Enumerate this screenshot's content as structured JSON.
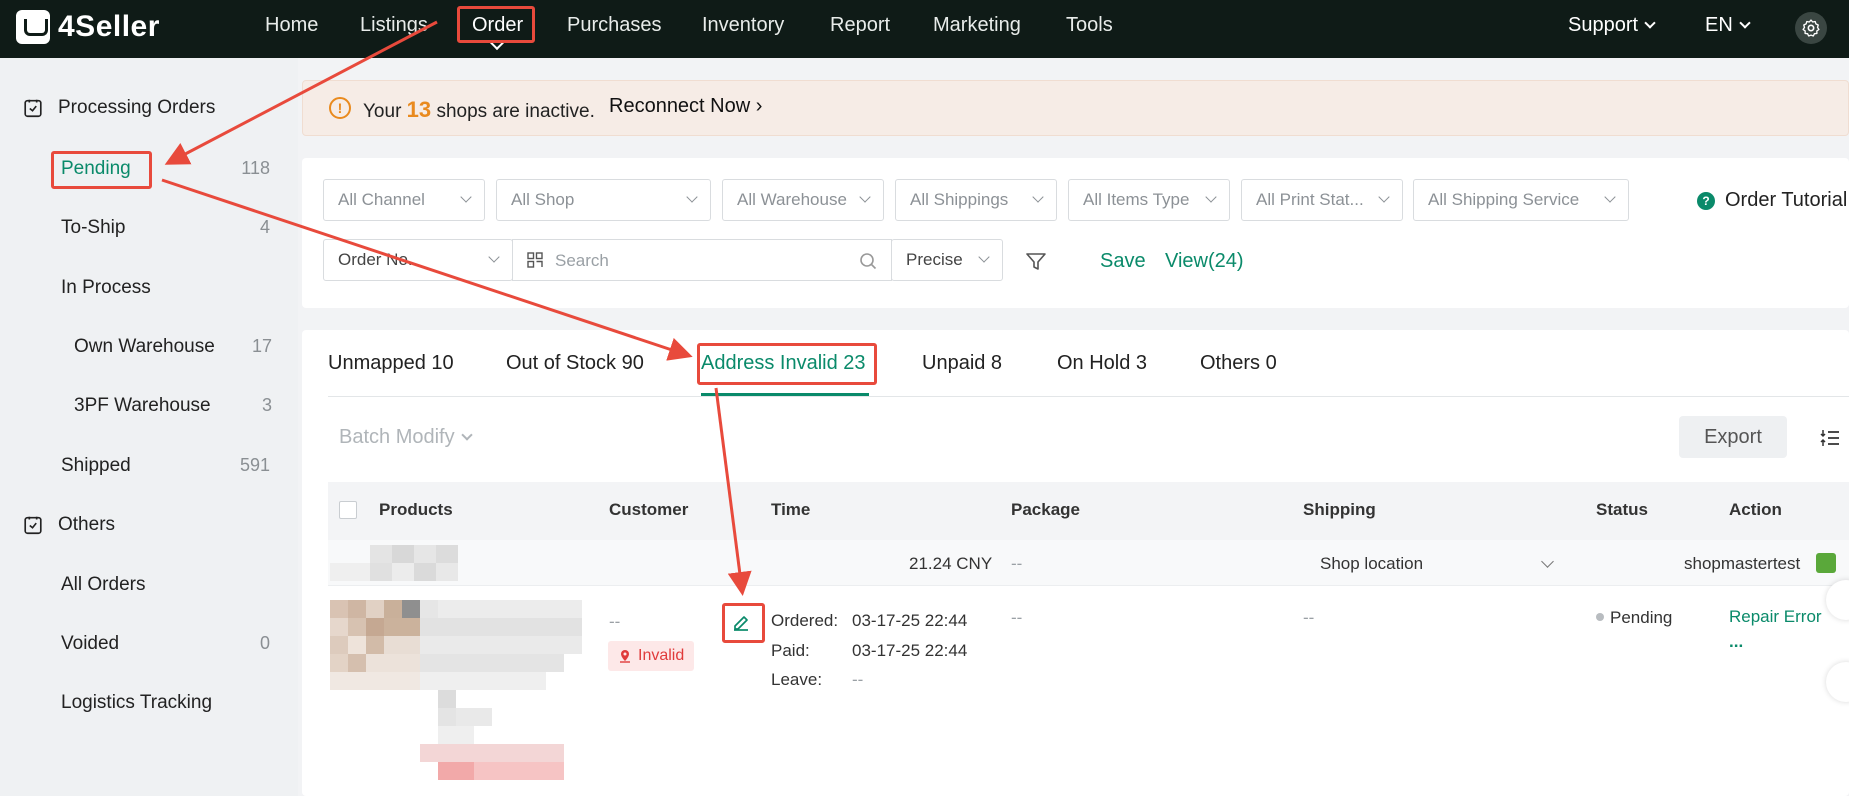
{
  "app": {
    "logo": "4Seller"
  },
  "nav": {
    "items": [
      "Home",
      "Listings",
      "Order",
      "Purchases",
      "Inventory",
      "Report",
      "Marketing",
      "Tools"
    ],
    "active": "Order",
    "support": "Support",
    "language": "EN"
  },
  "sidebar": {
    "processing_title": "Processing Orders",
    "pending": {
      "label": "Pending",
      "count": "118"
    },
    "to_ship": {
      "label": "To-Ship",
      "count": "4"
    },
    "in_process": {
      "label": "In Process"
    },
    "own_warehouse": {
      "label": "Own Warehouse",
      "count": "17"
    },
    "tpf_warehouse": {
      "label": "3PF Warehouse",
      "count": "3"
    },
    "shipped": {
      "label": "Shipped",
      "count": "591"
    },
    "others_title": "Others",
    "all_orders": {
      "label": "All Orders"
    },
    "voided": {
      "label": "Voided",
      "count": "0"
    },
    "logistics": {
      "label": "Logistics Tracking"
    }
  },
  "banner": {
    "text_before": "Your",
    "count": "13",
    "text_after": "shops are inactive.",
    "link": "Reconnect Now",
    "link_arrow": "›"
  },
  "filters": {
    "channel": "All Channel",
    "shop": "All Shop",
    "warehouse": "All Warehouse",
    "shippings": "All Shippings",
    "items_type": "All Items Type",
    "print_status": "All Print Stat...",
    "shipping_service": "All Shipping Service",
    "order_no": "Order No.",
    "search_placeholder": "Search",
    "match": "Precise",
    "save": "Save",
    "view": "View(24)",
    "tutorial": "Order Tutorial"
  },
  "tabs": {
    "unmapped": "Unmapped 10",
    "out_of_stock": "Out of Stock 90",
    "address_invalid": "Address Invalid 23",
    "unpaid": "Unpaid 8",
    "on_hold": "On Hold 3",
    "others": "Others 0"
  },
  "toolbar": {
    "batch_modify": "Batch Modify",
    "export": "Export"
  },
  "table": {
    "headers": {
      "products": "Products",
      "customer": "Customer",
      "time": "Time",
      "package": "Package",
      "shipping": "Shipping",
      "status": "Status",
      "action": "Action"
    },
    "group": {
      "amount": "21.24 CNY",
      "package": "--",
      "shipping_from": "Shop location",
      "shop": "shopmastertest"
    },
    "row": {
      "customer": "--",
      "invalid_badge": "Invalid",
      "ordered_label": "Ordered:",
      "ordered": "03-17-25 22:44",
      "paid_label": "Paid:",
      "paid": "03-17-25 22:44",
      "leave_label": "Leave:",
      "leave": "--",
      "package": "--",
      "shipping": "--",
      "status": "Pending",
      "action": "Repair Error",
      "more": "..."
    }
  },
  "colors": {
    "brand_green": "#0a8a6a",
    "topbar": "#0f1b17",
    "annotation_red": "#e84a3c",
    "warning_orange": "#e98a1e"
  }
}
